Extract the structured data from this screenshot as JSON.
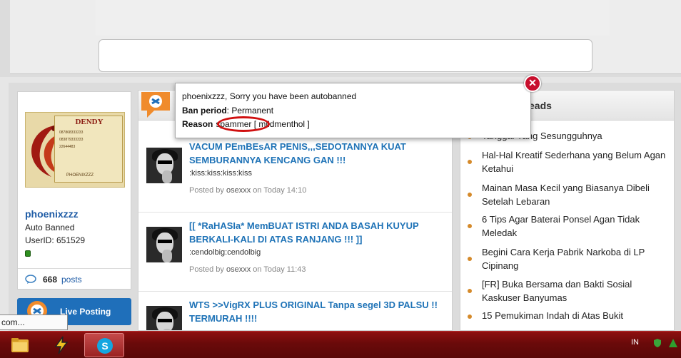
{
  "modal": {
    "message": "phoenixzzz, Sorry you have been autobanned",
    "ban_label": "Ban period",
    "ban_value": ": Permanent",
    "reason_label": "Reason",
    "reason_value": "spammer",
    "reason_sep": " [ ",
    "reason_user": "mildmenthol ]"
  },
  "profile": {
    "avatar_title": "DENDY",
    "avatar_line1": "087868333233",
    "avatar_line2": "083879333333",
    "avatar_line3": "22644483",
    "avatar_caption": "PHOENIXZZZ",
    "username": "phoenixzzz",
    "status": "Auto Banned",
    "userid": "UserID: 651529",
    "posts_count": "668",
    "posts_label": "posts"
  },
  "live_posting": {
    "label": "Live Posting"
  },
  "threads": [
    {
      "title": "VACUM PEmBEsAR PENIS,,,SEDOTANNYA KUAT SEMBURANNYA KENCANG GAN !!!",
      "snippet": ":kiss:kiss:kiss:kiss",
      "posted_by_label": "Posted by",
      "author": "osexxx",
      "when": "on Today 14:10"
    },
    {
      "title": "[[ *RaHASIa* MemBUAT ISTRI ANDA BASAH KUYUP BERKALI-KALI DI ATAS RANJANG !!! ]]",
      "snippet": ":cendolbig:cendolbig",
      "posted_by_label": "Posted by",
      "author": "osexxx",
      "when": "on Today 11:43"
    },
    {
      "title": "WTS >>VigRX PLUS ORIGINAL Tanpa segel 3D PALSU !! TERMURAH !!!!",
      "snippet": "",
      "posted_by_label": "",
      "author": "",
      "when": ""
    }
  ],
  "hot_threads": {
    "title_visible": "eads",
    "items": [
      "Tanggal Yang Sesungguhnya",
      "Hal-Hal Kreatif Sederhana yang Belum Agan Ketahui",
      "Mainan Masa Kecil yang Biasanya Dibeli Setelah Lebaran",
      "6 Tips Agar Baterai Ponsel Agan Tidak Meledak",
      "Begini Cara Kerja Pabrik Narkoba di LP Cipinang",
      "[FR] Buka Bersama dan Bakti Sosial Kaskuser Banyumas",
      "15 Pemukiman Indah di Atas Bukit"
    ]
  },
  "tooltip": {
    "text": "com..."
  },
  "taskbar": {
    "apps": [
      "folder-icon",
      "winamp-icon",
      "skype-icon"
    ],
    "tray_lang": "IN"
  },
  "colors": {
    "link_blue": "#1f73b7",
    "taskbar_red": "#7a0c0c",
    "close_red": "#c8102e",
    "annotation_red": "#d01010"
  }
}
